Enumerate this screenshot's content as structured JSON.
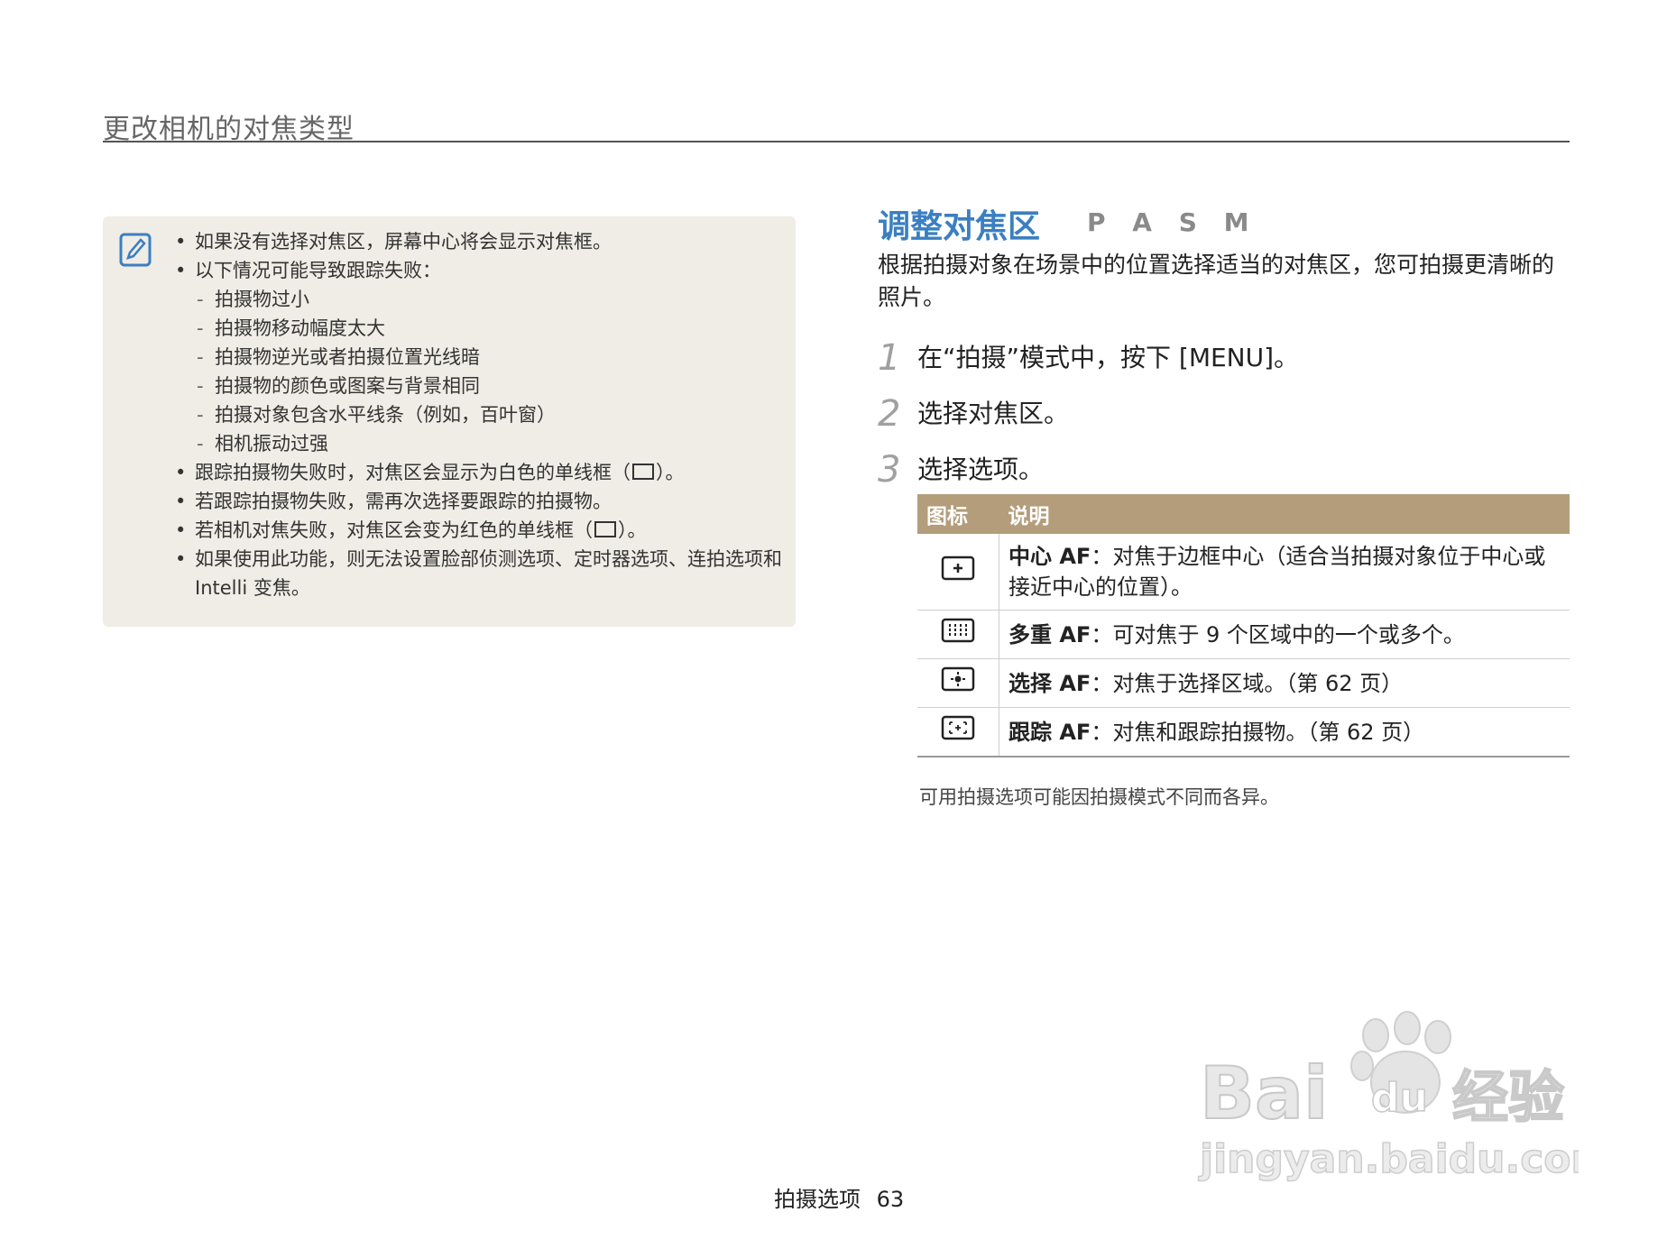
{
  "header": {
    "title": "更改相机的对焦类型"
  },
  "note": {
    "icon": "note-pencil-icon",
    "items": [
      {
        "type": "bullet",
        "text": "如果没有选择对焦区，屏幕中心将会显示对焦框。"
      },
      {
        "type": "bullet",
        "text": "以下情况可能导致跟踪失败："
      },
      {
        "type": "dash",
        "text": "拍摄物过小"
      },
      {
        "type": "dash",
        "text": "拍摄物移动幅度太大"
      },
      {
        "type": "dash",
        "text": "拍摄物逆光或者拍摄位置光线暗"
      },
      {
        "type": "dash",
        "text": "拍摄物的颜色或图案与背景相同"
      },
      {
        "type": "dash",
        "text": "拍摄对象包含水平线条（例如，百叶窗）"
      },
      {
        "type": "dash",
        "text": "相机振动过强"
      },
      {
        "type": "bullet-frame",
        "text_before": "跟踪拍摄物失败时，对焦区会显示为白色的单线框（",
        "text_after": "）。"
      },
      {
        "type": "bullet",
        "text": "若跟踪拍摄物失败，需再次选择要跟踪的拍摄物。"
      },
      {
        "type": "bullet-frame",
        "text_before": "若相机对焦失败，对焦区会变为红色的单线框（",
        "text_after": "）。"
      },
      {
        "type": "bullet",
        "text": "如果使用此功能，则无法设置脸部侦测选项、定时器选项、连拍选项和 Intelli 变焦。"
      }
    ]
  },
  "section": {
    "title": "调整对焦区",
    "modes": "P A S M",
    "intro": "根据拍摄对象在场景中的位置选择适当的对焦区，您可拍摄更清晰的照片。"
  },
  "steps": [
    {
      "num": "1",
      "text": "在“拍摄”模式中，按下 [MENU]。"
    },
    {
      "num": "2",
      "text": "选择对焦区。"
    },
    {
      "num": "3",
      "text": "选择选项。"
    }
  ],
  "table": {
    "headers": {
      "icon": "图标",
      "desc": "说明"
    },
    "rows": [
      {
        "icon": "center-af-icon",
        "term": "中心 AF",
        "desc": "：对焦于边框中心（适合当拍摄对象位于中心或接近中心的位置）。"
      },
      {
        "icon": "multi-af-icon",
        "term": "多重 AF",
        "desc": "：可对焦于 9 个区域中的一个或多个。"
      },
      {
        "icon": "selection-af-icon",
        "term": "选择 AF",
        "desc": "：对焦于选择区域。（第 62 页）"
      },
      {
        "icon": "tracking-af-icon",
        "term": "跟踪 AF",
        "desc": "：对焦和跟踪拍摄物。（第 62 页）"
      }
    ]
  },
  "footnote": "可用拍摄选项可能因拍摄模式不同而各异。",
  "footer": {
    "section": "拍摄选项",
    "page": "63"
  },
  "watermark": {
    "brand": "Baidu经验",
    "url": "jingyan.baidu.com"
  },
  "colors": {
    "accent_blue": "#3a7fc1",
    "table_header": "#b39d7b",
    "note_bg": "#f0ece6"
  }
}
